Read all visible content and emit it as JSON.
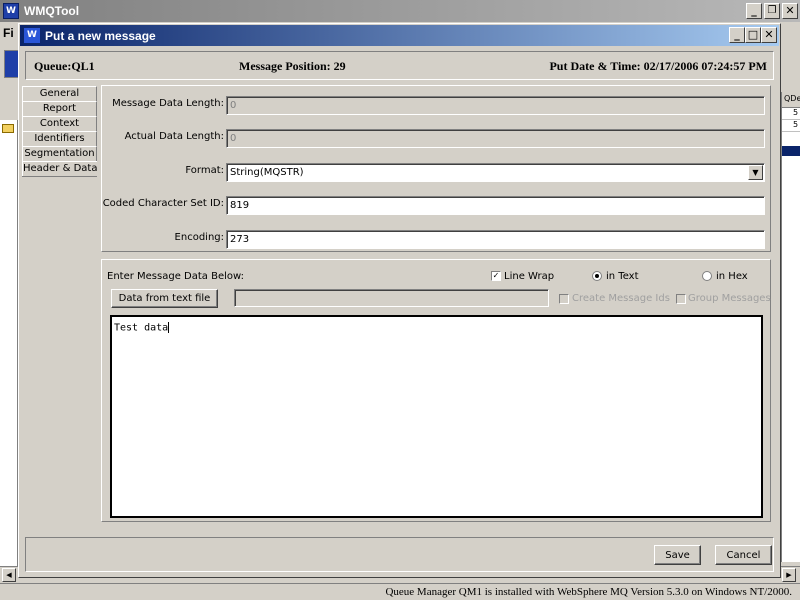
{
  "app": {
    "title": "WMQTool",
    "icon_glyph": "W",
    "menu_first": "Fi",
    "side_header": "QDe",
    "side_rows": [
      "5",
      "5"
    ]
  },
  "dialog": {
    "title": "Put a new message",
    "icon_glyph": "W",
    "header": {
      "queue": "Queue:QL1",
      "position": "Message Position: 29",
      "datetime": "Put Date & Time: 02/17/2006 07:24:57 PM"
    },
    "tabs": [
      {
        "label": "General"
      },
      {
        "label": "Report"
      },
      {
        "label": "Context"
      },
      {
        "label": "Identifiers"
      },
      {
        "label": "Segmentation"
      },
      {
        "label": "Header & Data"
      }
    ],
    "fields": {
      "msg_data_length_label": "Message Data Length:",
      "msg_data_length_value": "0",
      "actual_data_length_label": "Actual Data Length:",
      "actual_data_length_value": "0",
      "format_label": "Format:",
      "format_value": "String(MQSTR)",
      "ccsid_label": "Coded Character Set ID:",
      "ccsid_value": "819",
      "encoding_label": "Encoding:",
      "encoding_value": "273"
    },
    "data_section": {
      "prompt": "Enter Message Data Below:",
      "line_wrap_label": "Line Wrap",
      "line_wrap_checked": true,
      "in_text_label": "in Text",
      "in_hex_label": "in Hex",
      "selected_mode": "text",
      "data_from_file_label": "Data from text file",
      "file_path_value": "",
      "create_msg_ids_label": "Create Message Ids",
      "group_messages_label": "Group Messages",
      "message_text": "Test data"
    },
    "buttons": {
      "save": "Save",
      "cancel": "Cancel"
    }
  },
  "status_bar": {
    "text": "Queue Manager QM1  is installed with WebSphere MQ Version 5.3.0 on Windows NT/2000."
  },
  "window_controls": {
    "minimize": "_",
    "restore": "❐",
    "close": "✕",
    "maximize": "□",
    "dropdown": "▼",
    "checkmark": "✓"
  }
}
